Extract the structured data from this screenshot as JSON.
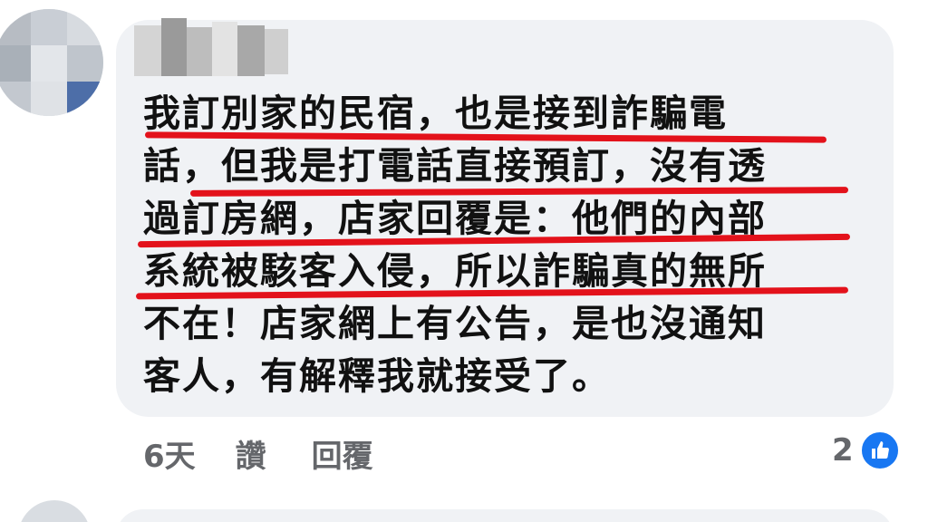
{
  "comment": {
    "lines": [
      "我訂別家的民宿，也是接到詐騙電",
      "話，但我是打電話直接預訂，沒有透",
      "過訂房網，店家回覆是：他們的內部",
      "系統被駭客入侵，所以詐騙真的無所",
      "不在！店家網上有公告，是也沒通知",
      "客人，有解釋我就接受了。"
    ],
    "highlight_color": "#e3121b"
  },
  "actions": {
    "time": "6天",
    "like": "讚",
    "reply": "回覆"
  },
  "reactions": {
    "count": "2",
    "icon": "thumbs-up-icon",
    "color": "#1877f2"
  }
}
